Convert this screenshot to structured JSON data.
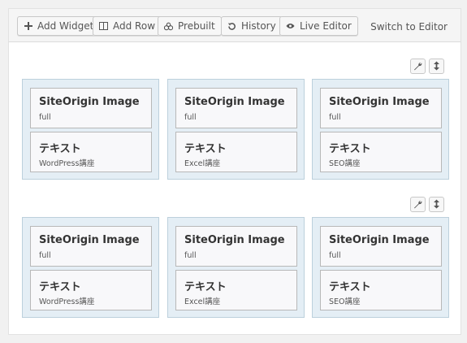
{
  "toolbar": {
    "buttons": [
      {
        "label": "Add Widget",
        "icon": "plus-icon"
      },
      {
        "label": "Add Row",
        "icon": "columns-icon"
      },
      {
        "label": "Prebuilt",
        "icon": "layouts-icon"
      },
      {
        "label": "History",
        "icon": "history-icon"
      },
      {
        "label": "Live Editor",
        "icon": "eye-icon"
      }
    ],
    "switch_label": "Switch to Editor"
  },
  "rows": [
    {
      "cells": [
        {
          "widgets": [
            {
              "title": "SiteOrigin Image",
              "subtitle": "full"
            },
            {
              "title": "テキスト",
              "subtitle": "WordPress講座"
            }
          ]
        },
        {
          "widgets": [
            {
              "title": "SiteOrigin Image",
              "subtitle": "full"
            },
            {
              "title": "テキスト",
              "subtitle": "Excel講座"
            }
          ]
        },
        {
          "widgets": [
            {
              "title": "SiteOrigin Image",
              "subtitle": "full"
            },
            {
              "title": "テキスト",
              "subtitle": "SEO講座"
            }
          ]
        }
      ]
    },
    {
      "cells": [
        {
          "widgets": [
            {
              "title": "SiteOrigin Image",
              "subtitle": "full"
            },
            {
              "title": "テキスト",
              "subtitle": "WordPress講座"
            }
          ]
        },
        {
          "widgets": [
            {
              "title": "SiteOrigin Image",
              "subtitle": "full"
            },
            {
              "title": "テキスト",
              "subtitle": "Excel講座"
            }
          ]
        },
        {
          "widgets": [
            {
              "title": "SiteOrigin Image",
              "subtitle": "full"
            },
            {
              "title": "テキスト",
              "subtitle": "SEO講座"
            }
          ]
        }
      ]
    }
  ],
  "colors": {
    "cell_bg": "#e4eef5",
    "cell_border": "#bcd0dc",
    "widget_bg": "#f8f8fa"
  }
}
